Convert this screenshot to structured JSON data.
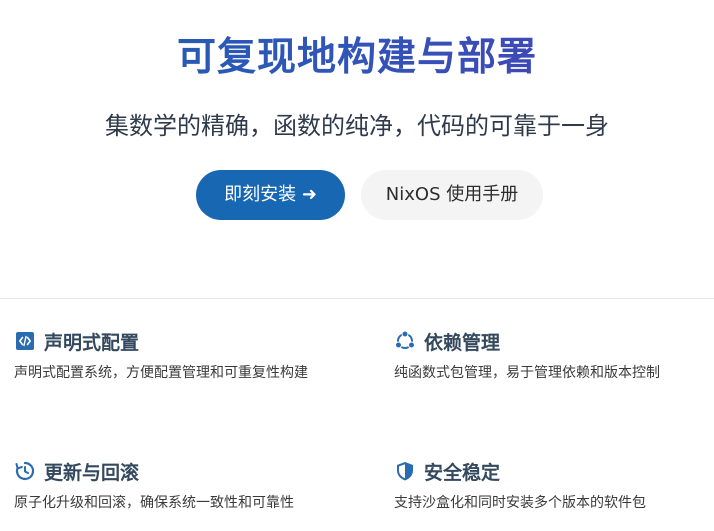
{
  "hero": {
    "title": "可复现地构建与部署",
    "subtitle": "集数学的精确，函数的纯净，代码的可靠于一身",
    "primary_button": "即刻安装 ➜",
    "secondary_button": "NixOS 使用手册"
  },
  "features": [
    {
      "icon": "code-icon",
      "title": "声明式配置",
      "description": "声明式配置系统，方便配置管理和可重复性构建"
    },
    {
      "icon": "dependency-icon",
      "title": "依赖管理",
      "description": "纯函数式包管理，易于管理依赖和版本控制"
    },
    {
      "icon": "update-icon",
      "title": "更新与回滚",
      "description": "原子化升级和回滚，确保系统一致性和可靠性"
    },
    {
      "icon": "shield-icon",
      "title": "安全稳定",
      "description": "支持沙盒化和同时安装多个版本的软件包"
    }
  ],
  "colors": {
    "accent": "#1767b2",
    "icon": "#2b6cb0",
    "heading": "#34495e"
  }
}
